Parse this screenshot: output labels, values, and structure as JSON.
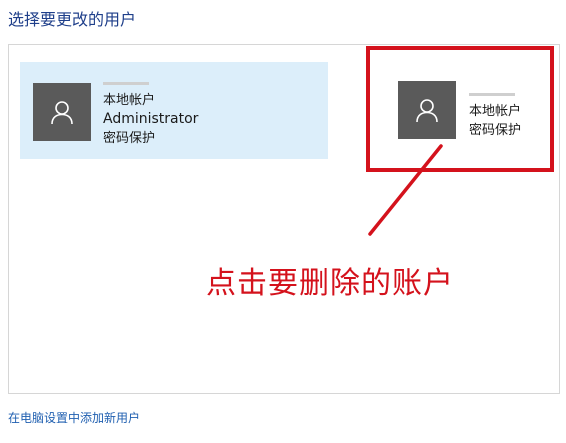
{
  "page": {
    "title": "选择要更改的用户"
  },
  "users": [
    {
      "account_type": "本地帐户",
      "role": "Administrator",
      "protection": "密码保护"
    },
    {
      "account_type": "本地帐户",
      "protection": "密码保护"
    }
  ],
  "annotation": {
    "text": "点击要删除的账户",
    "color": "#d4121c"
  },
  "footer": {
    "add_user_link": "在电脑设置中添加新用户"
  },
  "colors": {
    "title": "#1f3f8a",
    "selected_tile_bg": "#dceefa",
    "avatar_bg": "#5a5a5a",
    "link": "#1f5fb0"
  },
  "icons": {
    "avatar": "user-silhouette-icon"
  }
}
